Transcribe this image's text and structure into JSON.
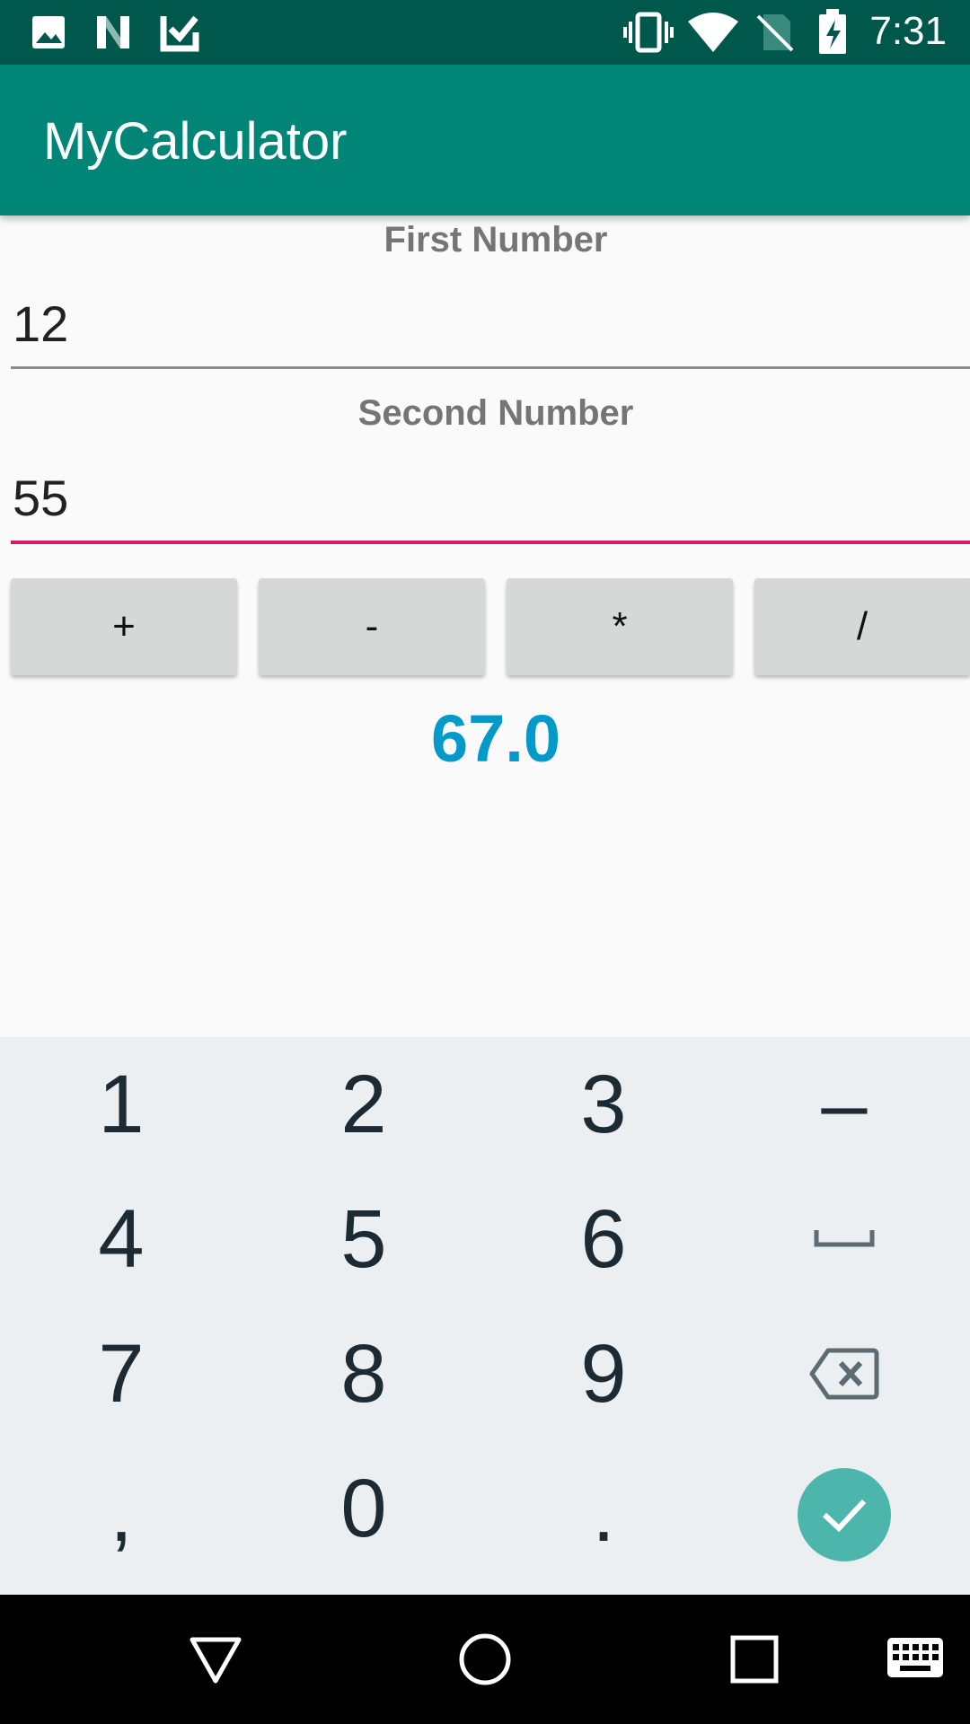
{
  "status_bar": {
    "time": "7:31",
    "left_icons": [
      "image-icon",
      "n-logo-icon",
      "task-check-icon"
    ],
    "right_icons": [
      "vibrate-icon",
      "wifi-icon",
      "no-sim-icon",
      "battery-charging-icon"
    ]
  },
  "app_bar": {
    "title": "MyCalculator",
    "color": "#008577"
  },
  "form": {
    "first_label": "First Number",
    "first_value": "12",
    "second_label": "Second Number",
    "second_value": "55"
  },
  "operators": [
    "+",
    "-",
    "*",
    "/"
  ],
  "result": "67.0",
  "result_color": "#0399c8",
  "accent_color": "#d81b60",
  "keyboard": {
    "rows": [
      [
        "1",
        "2",
        "3",
        "–"
      ],
      [
        "4",
        "5",
        "6",
        "space-icon"
      ],
      [
        "7",
        "8",
        "9",
        "backspace-icon"
      ],
      [
        ",",
        "0",
        ".",
        "done-check-icon"
      ]
    ]
  },
  "nav_bar": [
    "back-icon",
    "home-icon",
    "recents-icon",
    "keyboard-icon"
  ]
}
